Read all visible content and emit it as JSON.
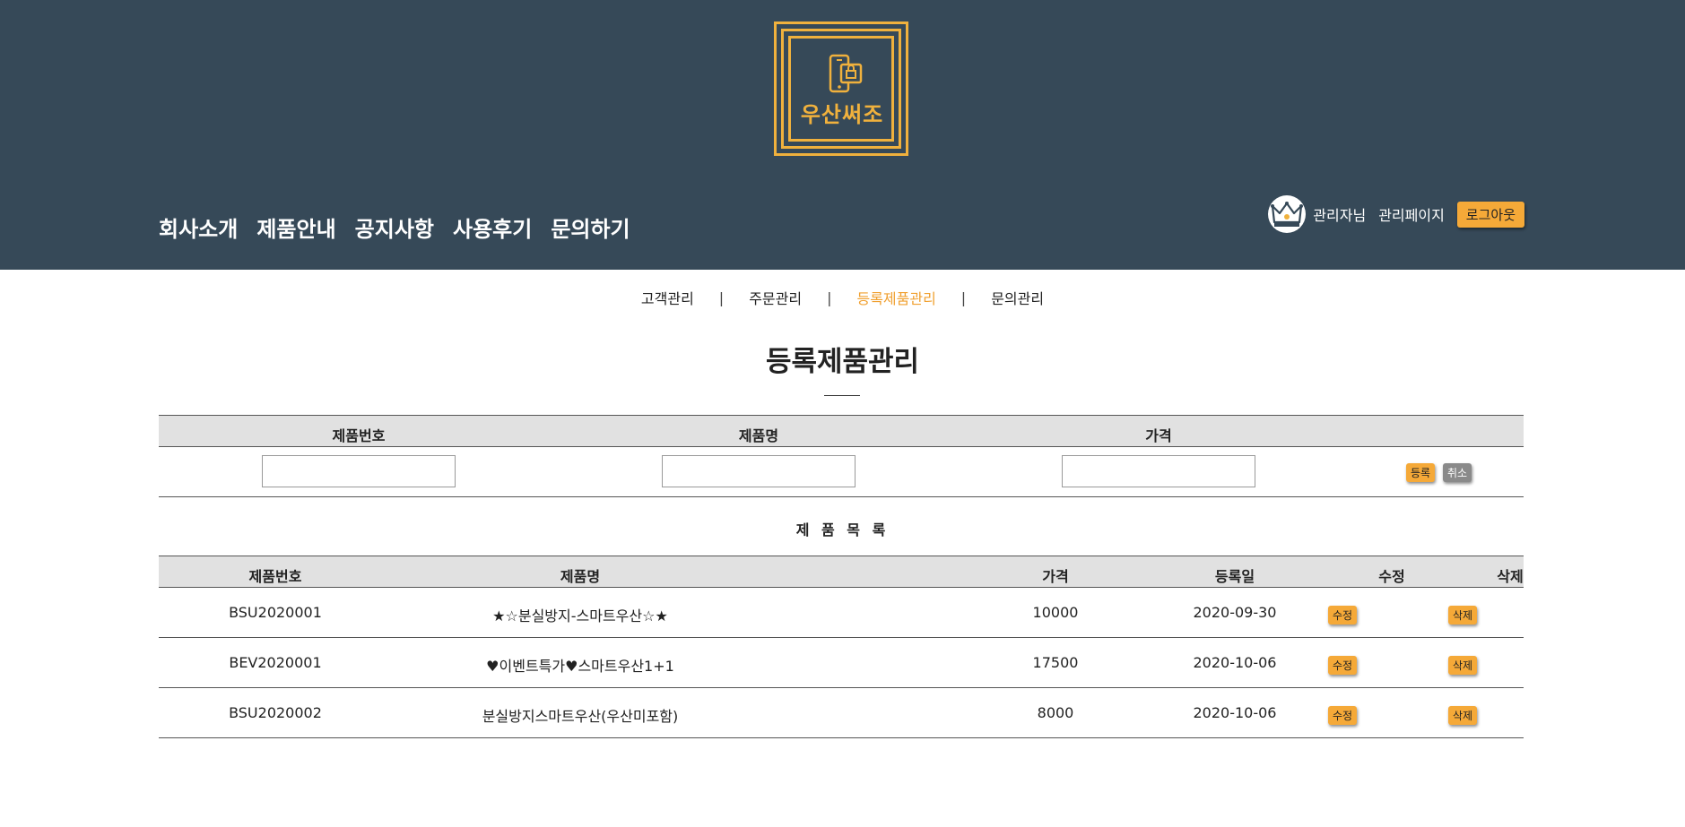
{
  "header": {
    "logo_text": "우산써조",
    "nav": [
      "회사소개",
      "제품안내",
      "공지사항",
      "사용후기",
      "문의하기"
    ],
    "user": {
      "greeting": "관리자님",
      "admin_link": "관리페이지",
      "logout_label": "로그아웃"
    },
    "colors": {
      "background": "#364958",
      "accent": "#f0b13d"
    }
  },
  "sub_nav": {
    "items": [
      "고객관리",
      "주문관리",
      "등록제품관리",
      "문의관리"
    ],
    "separator": "|",
    "active": "등록제품관리"
  },
  "page_title": "등록제품관리",
  "register_form": {
    "headers": [
      "제품번호",
      "제품명",
      "가격"
    ],
    "values": [
      "",
      "",
      ""
    ],
    "submit_label": "등록",
    "cancel_label": "취소"
  },
  "list": {
    "title": "제 품 목 록",
    "headers": [
      "제품번호",
      "제품명",
      "가격",
      "등록일",
      "수정",
      "삭제"
    ],
    "edit_label": "수정",
    "delete_label": "삭제",
    "rows": [
      [
        "BSU2020001",
        "★☆분실방지-스마트우산☆★",
        "10000",
        "2020-09-30"
      ],
      [
        "BEV2020001",
        "♥이벤트특가♥스마트우산1+1",
        "17500",
        "2020-10-06"
      ],
      [
        "BSU2020002",
        "분실방지스마트우산(우산미포함)",
        "8000",
        "2020-10-06"
      ]
    ]
  }
}
